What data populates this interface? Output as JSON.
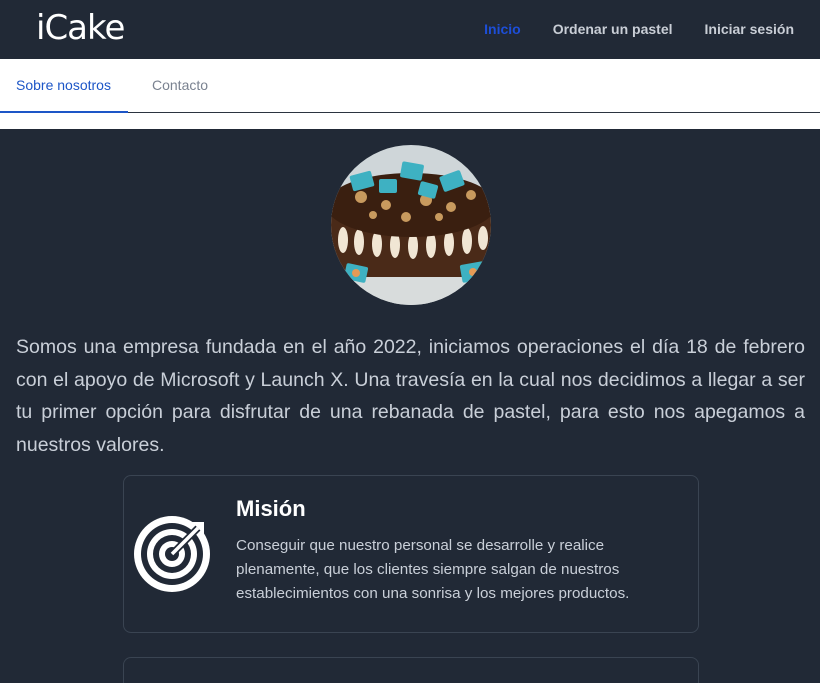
{
  "navbar": {
    "logo": "iCake",
    "links": [
      {
        "label": "Inicio",
        "active": true
      },
      {
        "label": "Ordenar un pastel",
        "active": false
      },
      {
        "label": "Iniciar sesión",
        "active": false
      }
    ]
  },
  "tabs": [
    {
      "label": "Sobre nosotros",
      "active": true
    },
    {
      "label": "Contacto",
      "active": false
    }
  ],
  "intro": "Somos una empresa fundada en el año 2022, iniciamos operaciones el día 18 de febrero con el apoyo de Microsoft y Launch X. Una travesía en la cual nos decidimos a llegar a ser tu primer opción para disfrutar de una rebanada de pastel, para esto nos apegamos a nuestros valores.",
  "cards": [
    {
      "title": "Misión",
      "icon": "target-icon",
      "text": "Conseguir que nuestro personal se desarrolle y realice plenamente, que los clientes siempre salgan de nuestros establecimientos con una sonrisa y los mejores productos."
    }
  ],
  "colors": {
    "background": "#212936",
    "active_link": "#1d4ed8",
    "active_tab": "#1d56c7"
  }
}
